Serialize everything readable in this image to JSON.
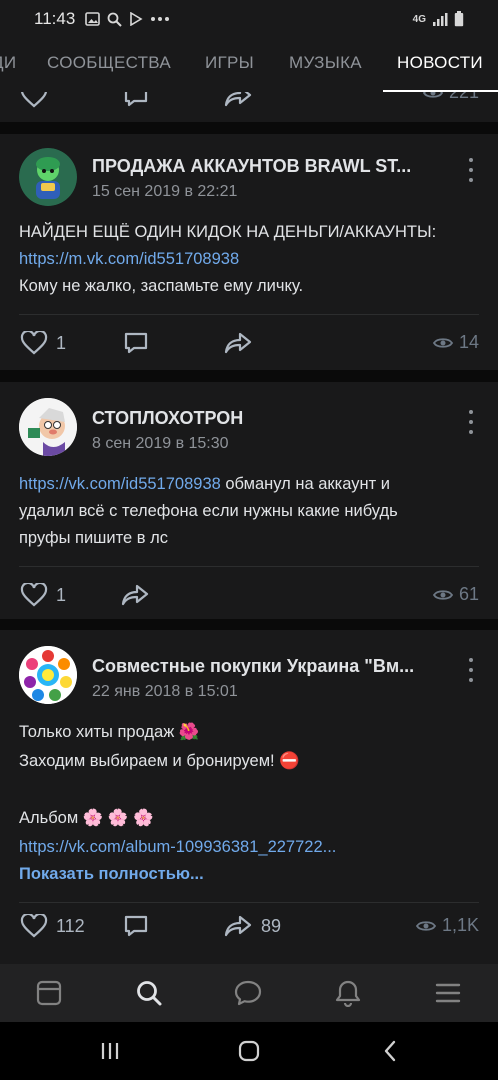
{
  "status_bar": {
    "time": "11:43",
    "network": "4G"
  },
  "tabs": [
    {
      "label": "ДИ"
    },
    {
      "label": "СООБЩЕСТВА"
    },
    {
      "label": "ИГРЫ"
    },
    {
      "label": "МУЗЫКА"
    },
    {
      "label": "НОВОСТИ",
      "active": true
    }
  ],
  "top_card": {
    "views": "221"
  },
  "posts": [
    {
      "author": "ПРОДАЖА АККАУНТОВ BRAWL ST...",
      "date": "15 сен 2019 в 22:21",
      "lines": [
        {
          "text": "НАЙДЕН ЕЩЁ ОДИН КИДОК НА ДЕНЬГИ/АККАУНТЫ:"
        },
        {
          "link": "https://m.vk.com/id551708938"
        },
        {
          "text": "Кому не жалко, заспамьте ему личку."
        }
      ],
      "likes": "1",
      "views": "14"
    },
    {
      "author": "СТОПЛОХОТРОН",
      "date": "8 сен 2019 в 15:30",
      "lines": [
        {
          "link": "https://vk.com/id551708938",
          "text": " обманул на аккаунт и"
        },
        {
          "text": "удалил всё с телефона если нужны какие нибудь"
        },
        {
          "text": "пруфы пишите в лс"
        }
      ],
      "likes": "1",
      "views": "61"
    },
    {
      "author": "Совместные покупки Украина \"Вм...",
      "date": "22 янв 2018 в 15:01",
      "lines": [
        {
          "text": "Только хиты продаж 🌺"
        },
        {
          "text": "Заходим выбираем и бронируем! ⛔"
        },
        {
          "text": "Альбом 🌸 🌸 🌸"
        },
        {
          "link": "https://vk.com/album-109936381_227722..."
        },
        {
          "more": "Показать полностью..."
        }
      ],
      "likes": "112",
      "shares": "89",
      "views": "1,1K"
    }
  ],
  "bottom_nav": [
    {
      "icon": "news-feed-icon"
    },
    {
      "icon": "search-icon",
      "active": true
    },
    {
      "icon": "messages-icon"
    },
    {
      "icon": "notifications-icon"
    },
    {
      "icon": "menu-icon"
    }
  ],
  "system_nav": [
    {
      "icon": "recent-apps-icon"
    },
    {
      "icon": "home-icon"
    },
    {
      "icon": "back-icon"
    }
  ],
  "colors": {
    "card_bg": "#19191a",
    "link": "#71aaeb",
    "secondary_text": "#8f9399"
  }
}
